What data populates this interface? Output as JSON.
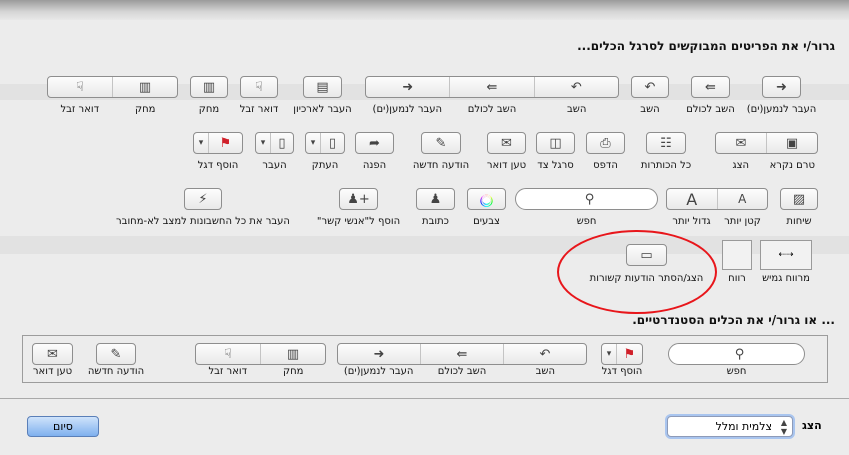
{
  "header": "גרור/י את הפריטים המבוקשים לסרגל הכלים...",
  "standard_header": "... או גרור/י את הכלים הסטנדרטיים.",
  "palette": [
    {
      "id": "forward",
      "labels": [
        "העבר לנמען(ים)"
      ],
      "icons": [
        "➜"
      ]
    },
    {
      "id": "reply-all",
      "labels": [
        "השב לכולם"
      ],
      "icons": [
        "⇚"
      ]
    },
    {
      "id": "reply",
      "labels": [
        "השב"
      ],
      "icons": [
        "↶"
      ]
    },
    {
      "id": "reply-group",
      "labels": [
        "העבר לנמען(ים)",
        "השב לכולם",
        "השב"
      ],
      "icons": [
        "➜",
        "⇚",
        "↶"
      ]
    },
    {
      "id": "archive",
      "labels": [
        "העבר לארכיון"
      ],
      "icons": [
        "▤"
      ]
    },
    {
      "id": "junk",
      "labels": [
        "דואר זבל"
      ],
      "icons": [
        "☟"
      ]
    },
    {
      "id": "delete",
      "labels": [
        "מחק"
      ],
      "icons": [
        "▥"
      ]
    },
    {
      "id": "delete-junk",
      "labels": [
        "דואר זבל",
        "מחק"
      ],
      "icons": [
        "☟",
        "▥"
      ]
    },
    {
      "id": "unread-show",
      "labels": [
        "הצג",
        "טרם נקרא"
      ],
      "icons": [
        "✉",
        "▣"
      ]
    },
    {
      "id": "all-headers",
      "labels": [
        "כל הכותרות"
      ],
      "icons": [
        "☷"
      ]
    },
    {
      "id": "print",
      "labels": [
        "הדפס"
      ],
      "icons": [
        "⎙"
      ]
    },
    {
      "id": "sidebar",
      "labels": [
        "סרגל צד"
      ],
      "icons": [
        "◫"
      ]
    },
    {
      "id": "get-mail",
      "labels": [
        "טען דואר"
      ],
      "icons": [
        "✉"
      ]
    },
    {
      "id": "new-message",
      "labels": [
        "הודעה חדשה"
      ],
      "icons": [
        "✎"
      ]
    },
    {
      "id": "redirect",
      "labels": [
        "הפנה"
      ],
      "icons": [
        "➦"
      ]
    },
    {
      "id": "copy",
      "labels": [
        "העתק"
      ],
      "icons": [
        "▾",
        "▯"
      ]
    },
    {
      "id": "move",
      "labels": [
        "העבר"
      ],
      "icons": [
        "▾",
        "▯"
      ]
    },
    {
      "id": "flag",
      "labels": [
        "הוסף דגל"
      ],
      "icons": [
        "▾",
        "⚑"
      ]
    },
    {
      "id": "conversations",
      "labels": [
        "שיחות"
      ],
      "icons": [
        "▨"
      ]
    },
    {
      "id": "font-size",
      "labels": [
        "גדול יותר",
        "קטן יותר"
      ],
      "icons": [
        "A",
        "A"
      ]
    },
    {
      "id": "search",
      "labels": [
        "חפש"
      ],
      "icons": [
        "⚲"
      ]
    },
    {
      "id": "colors",
      "labels": [
        "צבעים"
      ],
      "icons": [
        "◉"
      ]
    },
    {
      "id": "address",
      "labels": [
        "כתובת"
      ],
      "icons": [
        "♟"
      ]
    },
    {
      "id": "add-contacts",
      "labels": [
        "הוסף ל\"אנשי קשר\""
      ],
      "icons": [
        "♟+"
      ]
    },
    {
      "id": "offline",
      "labels": [
        "העבר את כל החשבונות למצב לא-מחובר"
      ],
      "icons": [
        "⚡"
      ]
    },
    {
      "id": "show-related",
      "labels": [
        "הצג/הסתר הודעות קשורות"
      ],
      "icons": [
        "▭"
      ]
    },
    {
      "id": "space",
      "labels": [
        "רווח"
      ],
      "icons": []
    },
    {
      "id": "flexible-space",
      "labels": [
        "מרווח גמיש"
      ],
      "icons": [
        "⇠⇢"
      ]
    }
  ],
  "standard": [
    {
      "id": "std-search",
      "labels": [
        "חפש"
      ],
      "icons": [
        "⚲"
      ]
    },
    {
      "id": "std-flag",
      "labels": [
        "הוסף דגל"
      ],
      "icons": [
        "▾",
        "⚑"
      ]
    },
    {
      "id": "std-reply-group",
      "labels": [
        "העבר לנמען(ים)",
        "השב לכולם",
        "השב"
      ],
      "icons": [
        "➜",
        "⇚",
        "↶"
      ]
    },
    {
      "id": "std-delete-junk",
      "labels": [
        "דואר זבל",
        "מחק"
      ],
      "icons": [
        "☟",
        "▥"
      ]
    },
    {
      "id": "std-new-message",
      "labels": [
        "הודעה חדשה"
      ],
      "icons": [
        "✎"
      ]
    },
    {
      "id": "std-get-mail",
      "labels": [
        "טען דואר"
      ],
      "icons": [
        "✉"
      ]
    }
  ],
  "footer": {
    "show_label": "הצג",
    "show_value": "צלמית ומלל",
    "done": "סיום"
  },
  "colors": {
    "flag": "#d0202a",
    "highlight": "#e8161b"
  }
}
